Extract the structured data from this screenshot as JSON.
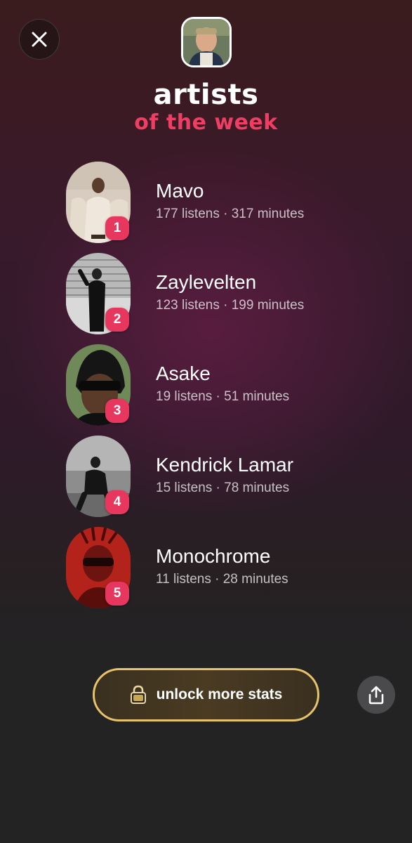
{
  "header": {
    "title": "artists",
    "subtitle": "of the week"
  },
  "colors": {
    "accent": "#ee3e63",
    "badge": "#e8375f",
    "gold_border": "#e6c26a"
  },
  "artists": [
    {
      "rank": "1",
      "name": "Mavo",
      "stats": "177 listens · 317 minutes"
    },
    {
      "rank": "2",
      "name": "Zaylevelten",
      "stats": "123 listens · 199 minutes"
    },
    {
      "rank": "3",
      "name": "Asake",
      "stats": "19 listens · 51 minutes"
    },
    {
      "rank": "4",
      "name": "Kendrick Lamar",
      "stats": "15 listens · 78 minutes"
    },
    {
      "rank": "5",
      "name": "Monochrome",
      "stats": "11 listens · 28 minutes"
    }
  ],
  "actions": {
    "unlock_label": "unlock more stats",
    "close_icon": "close-icon",
    "share_icon": "share-icon",
    "lock_icon": "lock-icon"
  }
}
